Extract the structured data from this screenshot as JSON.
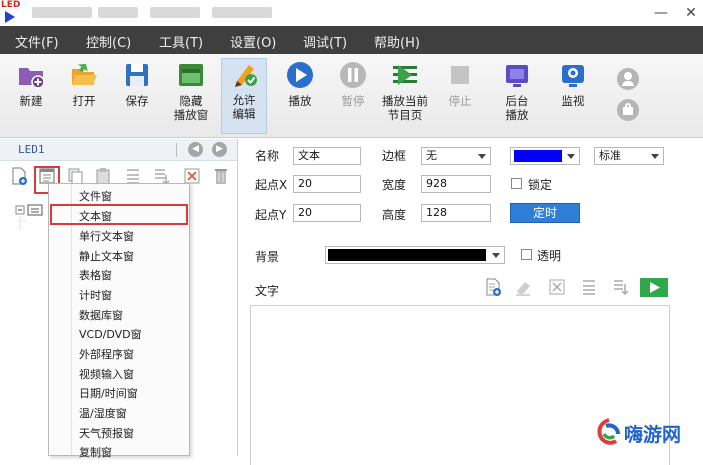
{
  "app": {
    "logo_text": "LED",
    "window_controls": {
      "minimize": "—",
      "close": "✕"
    }
  },
  "menubar": [
    {
      "label": "文件(F)"
    },
    {
      "label": "控制(C)"
    },
    {
      "label": "工具(T)"
    },
    {
      "label": "设置(O)"
    },
    {
      "label": "调试(T)"
    },
    {
      "label": "帮助(H)"
    }
  ],
  "toolbar": [
    {
      "label": "新建",
      "icon": "new-folder-icon",
      "enabled": true
    },
    {
      "label": "打开",
      "icon": "open-folder-icon",
      "enabled": true
    },
    {
      "label": "保存",
      "icon": "save-icon",
      "enabled": true
    },
    {
      "label": "隐藏\n播放窗",
      "icon": "hide-window-icon",
      "enabled": true
    },
    {
      "label": "允许\n编辑",
      "icon": "pencil-icon",
      "enabled": true,
      "active": true
    },
    {
      "label": "播放",
      "icon": "play-icon",
      "enabled": true
    },
    {
      "label": "暂停",
      "icon": "pause-icon",
      "enabled": false
    },
    {
      "label": "播放当前\n节目页",
      "icon": "play-current-page-icon",
      "enabled": true
    },
    {
      "label": "停止",
      "icon": "stop-icon",
      "enabled": false
    },
    {
      "label": "后台\n播放",
      "icon": "background-play-icon",
      "enabled": true
    },
    {
      "label": "监视",
      "icon": "monitor-icon",
      "enabled": true
    }
  ],
  "left_pane": {
    "title": "LED1",
    "nav_prev": "◀",
    "nav_next": "▶"
  },
  "dropdown": {
    "items": [
      "文件窗",
      "文本窗",
      "单行文本窗",
      "静止文本窗",
      "表格窗",
      "计时窗",
      "数据库窗",
      "VCD/DVD窗",
      "外部程序窗",
      "视频输入窗",
      "日期/时间窗",
      "温/湿度窗",
      "天气预报窗",
      "复制窗"
    ],
    "selected": "文本窗"
  },
  "properties": {
    "name_label": "名称",
    "name_value": "文本",
    "border_label": "边框",
    "border_value": "无",
    "border_color": "#0000ff",
    "style_value": "标准",
    "x_label": "起点X",
    "x_value": "20",
    "width_label": "宽度",
    "width_value": "928",
    "lock_label": "锁定",
    "y_label": "起点Y",
    "y_value": "20",
    "height_label": "高度",
    "height_value": "128",
    "timer_button": "定时",
    "bg_label": "背景",
    "bg_color": "#000000",
    "transparent_label": "透明",
    "text_label": "文字"
  },
  "watermark": {
    "text": "嗨游网"
  },
  "colors": {
    "menubar_bg": "#3f3f3f",
    "accent": "#2f7fd8",
    "highlight_red": "#d83b3b"
  }
}
